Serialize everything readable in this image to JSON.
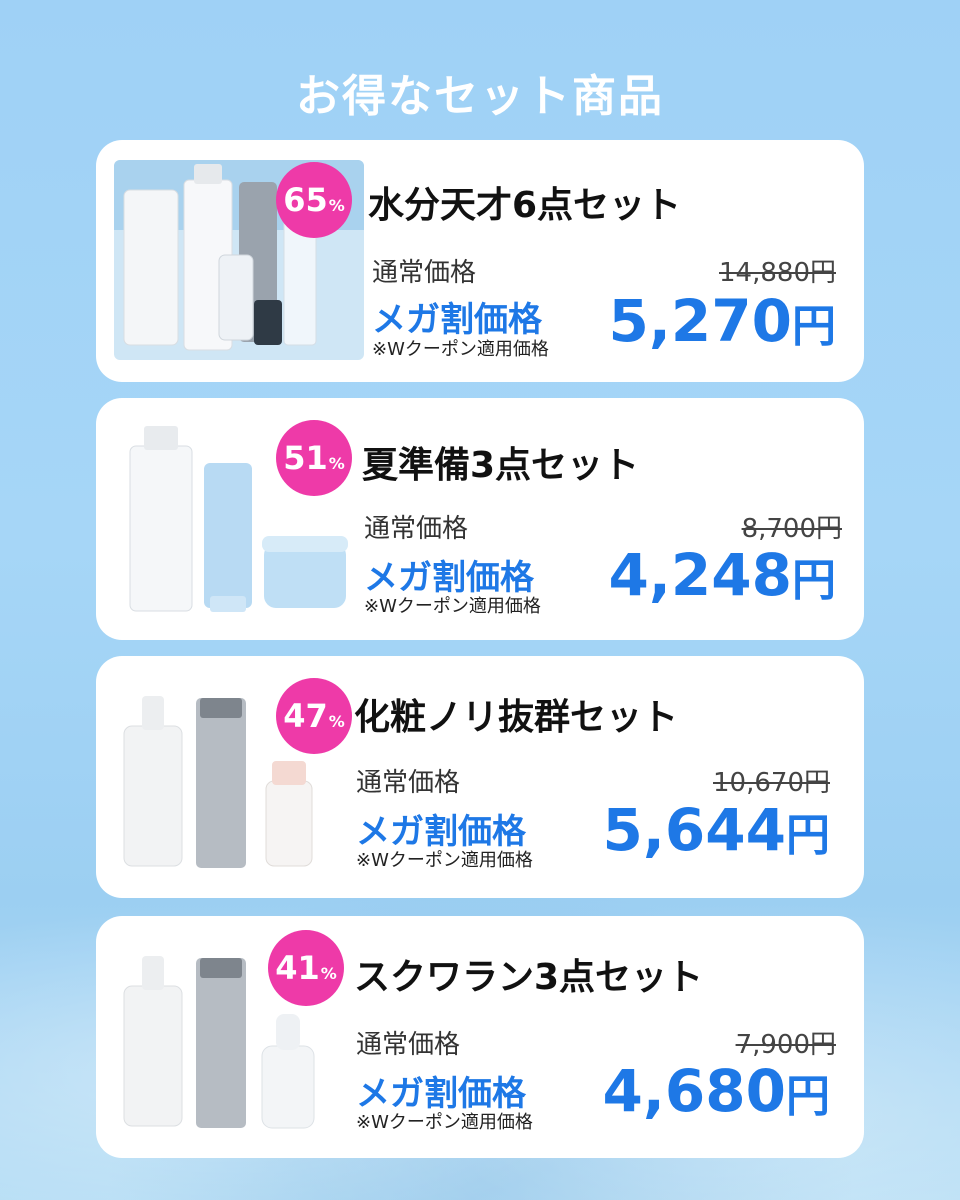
{
  "header": {
    "title": "お得なセット商品"
  },
  "sets": [
    {
      "discount": "65",
      "percent_sign": "%",
      "name": "水分天才6点セット",
      "regular_label": "通常価格",
      "regular_price": "14,880円",
      "mega_label": "メガ割価格",
      "coupon_note": "※Wクーポン適用価格",
      "sale_price": "5,270",
      "yen": "円"
    },
    {
      "discount": "51",
      "percent_sign": "%",
      "name": "夏準備3点セット",
      "regular_label": "通常価格",
      "regular_price": "8,700円",
      "mega_label": "メガ割価格",
      "coupon_note": "※Wクーポン適用価格",
      "sale_price": "4,248",
      "yen": "円"
    },
    {
      "discount": "47",
      "percent_sign": "%",
      "name": "化粧ノリ抜群セット",
      "regular_label": "通常価格",
      "regular_price": "10,670円",
      "mega_label": "メガ割価格",
      "coupon_note": "※Wクーポン適用価格",
      "sale_price": "5,644",
      "yen": "円"
    },
    {
      "discount": "41",
      "percent_sign": "%",
      "name": "スクワラン3点セット",
      "regular_label": "通常価格",
      "regular_price": "7,900円",
      "mega_label": "メガ割価格",
      "coupon_note": "※Wクーポン適用価格",
      "sale_price": "4,680",
      "yen": "円"
    }
  ],
  "colors": {
    "background": "#a6d6f7",
    "badge": "#ee3aa8",
    "accent_blue": "#1e78e6",
    "card": "#ffffff"
  },
  "icons": [
    "product-photo-icon"
  ]
}
